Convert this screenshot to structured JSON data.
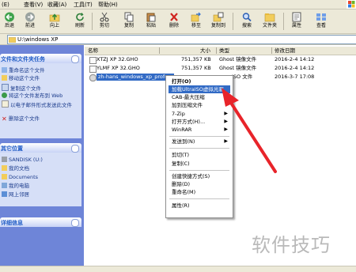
{
  "menubar": {
    "items": [
      "(E)",
      "查看(V)",
      "收藏(A)",
      "工具(T)",
      "帮助(H)"
    ]
  },
  "toolbar": {
    "buttons": [
      {
        "label": "后退",
        "icon": "back-arrow-icon"
      },
      {
        "label": "前进",
        "icon": "forward-arrow-icon"
      },
      {
        "label": "向上",
        "icon": "up-folder-icon"
      },
      {
        "label": "刷新",
        "icon": "refresh-icon"
      },
      {
        "label": "剪切",
        "icon": "cut-icon"
      },
      {
        "label": "复制",
        "icon": "copy-icon"
      },
      {
        "label": "粘贴",
        "icon": "paste-icon"
      },
      {
        "label": "删除",
        "icon": "delete-icon"
      },
      {
        "label": "移至",
        "icon": "move-to-icon"
      },
      {
        "label": "复制到",
        "icon": "copy-to-icon"
      },
      {
        "label": "搜索",
        "icon": "search-icon"
      },
      {
        "label": "文件夹",
        "icon": "folders-icon"
      },
      {
        "label": "属性",
        "icon": "properties-icon"
      },
      {
        "label": "查看",
        "icon": "views-icon"
      }
    ]
  },
  "address": {
    "path": "U:\\windows XP"
  },
  "left_pane": {
    "tasks": {
      "title": "文件和文件夹任务",
      "items": [
        "重命名这个文件",
        "移动这个文件",
        "复制这个文件",
        "将这个文件发布到 Web",
        "以电子邮件形式发送此文件",
        "删除这个文件"
      ]
    },
    "places": {
      "title": "其它位置",
      "items": [
        "SANDISK (U:)",
        "我的文档",
        "Documents",
        "我的电脑",
        "网上邻居"
      ]
    },
    "details": {
      "title": "详细信息"
    }
  },
  "file_list": {
    "columns": [
      "名称",
      "大小",
      "类型",
      "修改日期"
    ],
    "rows": [
      {
        "name": "XTZJ XP 32.GHO",
        "size": "751,357 KB",
        "type": "Ghost 镜像文件",
        "date": "2016-2-4 14:12"
      },
      {
        "name": "YLMF XP 32.GHO",
        "size": "751,357 KB",
        "type": "Ghost 镜像文件",
        "date": "2016-2-4 14:12"
      },
      {
        "name": "zh-hans_windows_xp_profe...",
        "size": "",
        "type": "ISO 文件",
        "date": "2016-3-7 17:08"
      }
    ]
  },
  "context_menu": {
    "items": [
      {
        "label": "打开(O)",
        "bold": true,
        "submenu": false
      },
      {
        "label": "加载UltraISO虚拟光驱",
        "highlighted": true,
        "submenu": false
      },
      {
        "label": "CAB-最大压缩",
        "submenu": false
      },
      {
        "label": "加到压缩文件",
        "submenu": false
      },
      {
        "label": "7-Zip",
        "submenu": true
      },
      {
        "label": "打开方式(H)...",
        "submenu": true
      },
      {
        "label": "WinRAR",
        "submenu": true
      },
      {
        "label": "发送到(N)",
        "submenu": true
      },
      {
        "label": "剪切(T)",
        "submenu": false
      },
      {
        "label": "复制(C)",
        "submenu": false
      },
      {
        "label": "创建快捷方式(S)",
        "submenu": false
      },
      {
        "label": "删除(D)",
        "submenu": false
      },
      {
        "label": "重命名(M)",
        "submenu": false
      },
      {
        "label": "属性(R)",
        "submenu": false
      }
    ]
  },
  "watermark": {
    "text": "软件技巧"
  },
  "colors": {
    "selection": "#316ac5",
    "arrow": "#e8242a",
    "task_pane": "#6e85d8"
  }
}
